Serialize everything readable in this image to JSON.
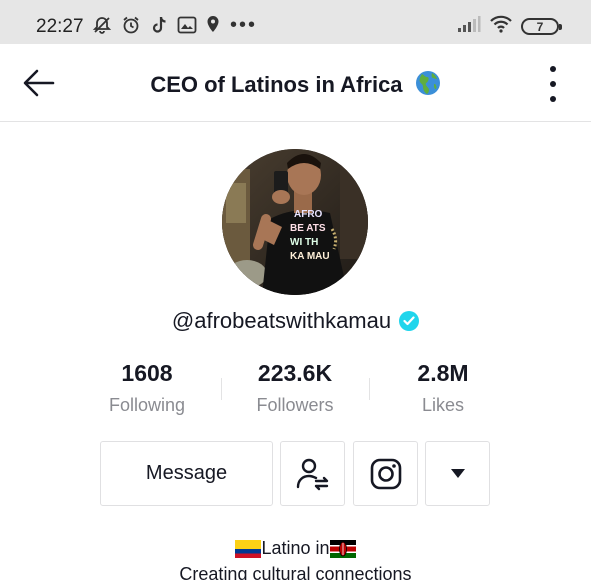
{
  "status_bar": {
    "time": "22:27",
    "battery": "7"
  },
  "header": {
    "title": "CEO of Latinos in Africa"
  },
  "profile": {
    "username": "@afrobeatswithkamau",
    "avatar_shirt_text": [
      "AFRO",
      "BE ATS",
      "WI TH",
      "KA MAU"
    ]
  },
  "stats": [
    {
      "value": "1608",
      "label": "Following"
    },
    {
      "value": "223.6K",
      "label": "Followers"
    },
    {
      "value": "2.8M",
      "label": "Likes"
    }
  ],
  "actions": {
    "message_label": "Message"
  },
  "bio": {
    "line1_prefix": "",
    "line1_mid": "Latino in",
    "line2": "Creating cultural connections"
  },
  "colors": {
    "verified": "#20d5ec",
    "text_primary": "#161823",
    "text_secondary": "#8a8b91",
    "border": "#e0e0e2"
  }
}
